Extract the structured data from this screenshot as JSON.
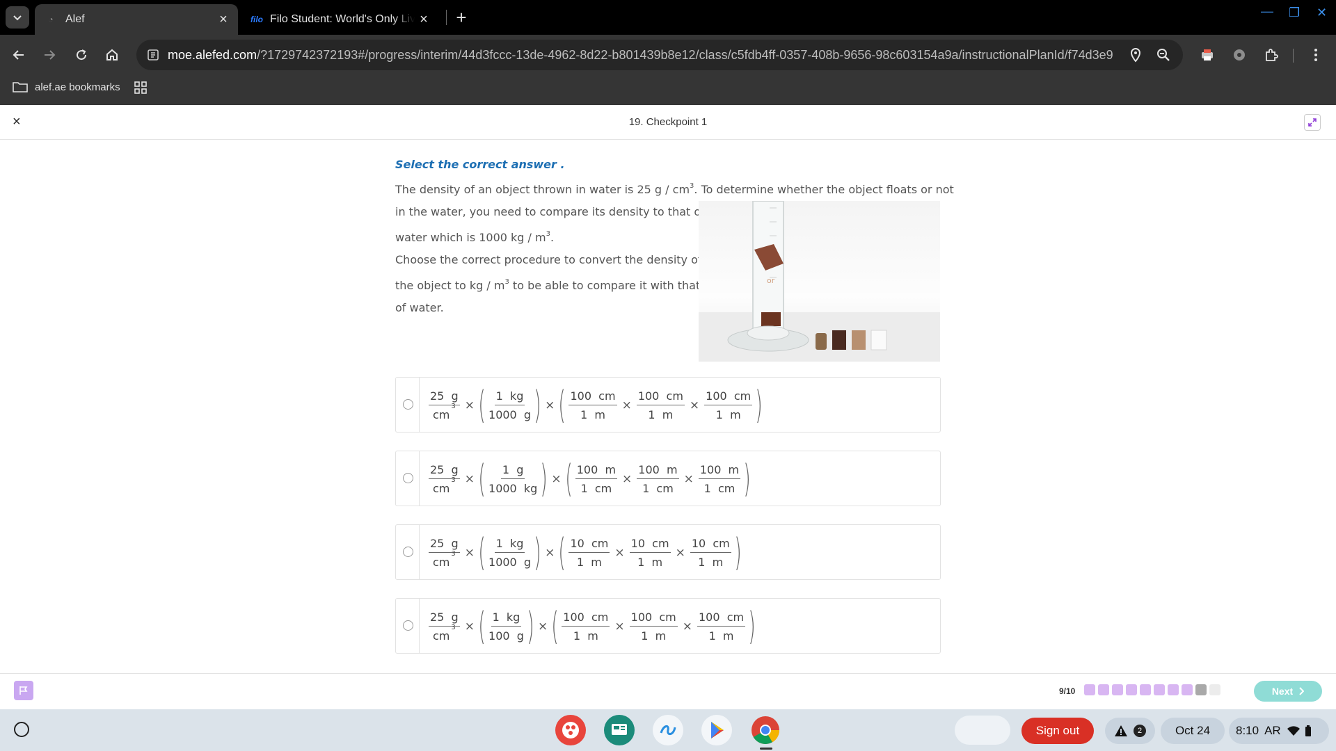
{
  "browser": {
    "tabs": [
      {
        "title": "Alef",
        "active": true
      },
      {
        "title": "Filo Student: World's Only Live Instant Tutoring Platform",
        "favicon_text": "filo",
        "active": false
      }
    ],
    "url_host": "moe.alefed.com",
    "url_path": "/?1729742372193#/progress/interim/44d3fccc-13de-4962-8d22-b801439b8e12/class/c5fdb4ff-0357-408b-9656-98c603154a9a/instructionalPlanId/f74d3e9...",
    "bookmarks": [
      {
        "label": "alef.ae bookmarks"
      }
    ]
  },
  "page": {
    "title": "19. Checkpoint 1",
    "close_glyph": "×"
  },
  "question": {
    "instruction": "Select the correct answer .",
    "line1_pre": "The density of an object thrown in water is  25  g / cm",
    "line1_sup": "3",
    "line1_post": ". To determine whether the object floats or not",
    "line2": "in the water, you need to compare its density to that of",
    "line3_pre": "water which is 1000  kg / m",
    "line3_sup": "3",
    "line3_post": ".",
    "line4": "Choose the correct procedure to convert the density of",
    "line5_pre": "the object to  kg / m",
    "line5_sup": "3",
    "line5_post": "  to be able to compare it with that",
    "line6": "of water.",
    "image_alt": "Graduated cylinder with floating and sinking cubes"
  },
  "options": [
    {
      "f1": {
        "num": "25  g",
        "den": "cm",
        "den_sup": "3"
      },
      "f2": {
        "num": "1  kg",
        "den": "1000  g"
      },
      "f3": {
        "num": "100  cm",
        "den": "1  m"
      },
      "f4": {
        "num": "100  cm",
        "den": "1  m"
      },
      "f5": {
        "num": "100  cm",
        "den": "1  m"
      }
    },
    {
      "f1": {
        "num": "25  g",
        "den": "cm",
        "den_sup": "3"
      },
      "f2": {
        "num": "1  g",
        "den": "1000  kg"
      },
      "f3": {
        "num": "100  m",
        "den": "1  cm"
      },
      "f4": {
        "num": "100  m",
        "den": "1  cm"
      },
      "f5": {
        "num": "100  m",
        "den": "1  cm"
      }
    },
    {
      "f1": {
        "num": "25  g",
        "den": "cm",
        "den_sup": "3"
      },
      "f2": {
        "num": "1  kg",
        "den": "1000  g"
      },
      "f3": {
        "num": "10  cm",
        "den": "1  m"
      },
      "f4": {
        "num": "10  cm",
        "den": "1  m"
      },
      "f5": {
        "num": "10  cm",
        "den": "1  m"
      }
    },
    {
      "f1": {
        "num": "25  g",
        "den": "cm",
        "den_sup": "3"
      },
      "f2": {
        "num": "1  kg",
        "den": "100  g"
      },
      "f3": {
        "num": "100  cm",
        "den": "1  m"
      },
      "f4": {
        "num": "100  cm",
        "den": "1  m"
      },
      "f5": {
        "num": "100  cm",
        "den": "1  m"
      }
    }
  ],
  "footer": {
    "progress_label": "9/10",
    "progress_total": 10,
    "progress_done": 8,
    "progress_current": 9,
    "next_label": "Next"
  },
  "shelf": {
    "apps": [
      "art-app-icon",
      "classroom-app-icon",
      "assistant-app-icon",
      "play-store-icon",
      "chrome-icon"
    ],
    "signout_label": "Sign out",
    "notification_count": "2",
    "date": "Oct 24",
    "time": "8:10",
    "ime": "AR"
  },
  "colors": {
    "accent_purple": "#c9a7f1",
    "next_teal": "#8fdcd6",
    "instruction_blue": "#1d6fb3",
    "signout_red": "#d93025"
  }
}
